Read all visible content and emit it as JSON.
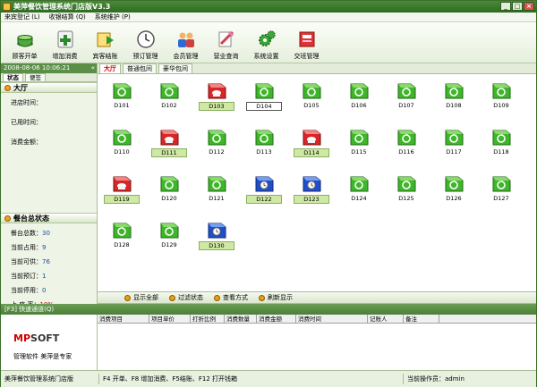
{
  "window": {
    "title": "美萍餐饮管理系统门店版V3.3",
    "min": "_",
    "max": "□",
    "close": "×"
  },
  "menu": [
    "来宾登记 (L)",
    "收银结算 (Q)",
    "系统维护 (P)"
  ],
  "toolbar": [
    {
      "label": "顾客开单",
      "icon": "teacup-icon"
    },
    {
      "label": "增加消费",
      "icon": "add-consume-icon"
    },
    {
      "label": "宾客结账",
      "icon": "checkout-icon"
    },
    {
      "label": "预订管理",
      "icon": "clock-icon"
    },
    {
      "label": "会员管理",
      "icon": "members-icon"
    },
    {
      "label": "营业查询",
      "icon": "search-icon"
    },
    {
      "label": "系统设置",
      "icon": "gear-icon"
    },
    {
      "label": "交班管理",
      "icon": "shift-icon"
    }
  ],
  "left": {
    "datetime": "2008-08-06 10:06:21",
    "collapse": "«",
    "tabs": [
      "状态",
      "便签"
    ],
    "hall_title": "大厅",
    "fields": [
      "进店时间：",
      "已用时间：",
      "消费金额："
    ],
    "stats_title": "餐台总状态",
    "stats": [
      {
        "label": "餐台总数：",
        "value": "30"
      },
      {
        "label": "当前占用：",
        "value": "9"
      },
      {
        "label": "当前可供：",
        "value": "76"
      },
      {
        "label": "当前预订：",
        "value": "1"
      },
      {
        "label": "当前停用：",
        "value": "0"
      },
      {
        "label": "上 座 率：",
        "value": "10%"
      }
    ]
  },
  "main": {
    "tabs": [
      "大厅",
      "普通包间",
      "豪华包间"
    ],
    "tables": [
      {
        "id": "D101",
        "state": "free"
      },
      {
        "id": "D102",
        "state": "free"
      },
      {
        "id": "D103",
        "state": "busy",
        "mark": "sel"
      },
      {
        "id": "D104",
        "state": "free",
        "mark": "box"
      },
      {
        "id": "D105",
        "state": "free"
      },
      {
        "id": "D106",
        "state": "free"
      },
      {
        "id": "D107",
        "state": "free"
      },
      {
        "id": "D108",
        "state": "free"
      },
      {
        "id": "D109",
        "state": "free"
      },
      {
        "id": "D110",
        "state": "free"
      },
      {
        "id": "D111",
        "state": "busy",
        "mark": "sel"
      },
      {
        "id": "D112",
        "state": "free"
      },
      {
        "id": "D113",
        "state": "free"
      },
      {
        "id": "D114",
        "state": "busy",
        "mark": "sel"
      },
      {
        "id": "D115",
        "state": "free"
      },
      {
        "id": "D116",
        "state": "free"
      },
      {
        "id": "D117",
        "state": "free"
      },
      {
        "id": "D118",
        "state": "free"
      },
      {
        "id": "D119",
        "state": "busy",
        "mark": "sel"
      },
      {
        "id": "D120",
        "state": "free"
      },
      {
        "id": "D121",
        "state": "free"
      },
      {
        "id": "D122",
        "state": "reserved",
        "mark": "sel"
      },
      {
        "id": "D123",
        "state": "reserved",
        "mark": "sel"
      },
      {
        "id": "D124",
        "state": "free"
      },
      {
        "id": "D125",
        "state": "free"
      },
      {
        "id": "D126",
        "state": "free"
      },
      {
        "id": "D127",
        "state": "free"
      },
      {
        "id": "D128",
        "state": "free"
      },
      {
        "id": "D129",
        "state": "free"
      },
      {
        "id": "D130",
        "state": "reserved",
        "mark": "sel"
      }
    ]
  },
  "actions": [
    "显示全部",
    "过滤状态",
    "查看方式",
    "刷新显示"
  ],
  "quick": {
    "label": "[F3] 快速通道(Q)"
  },
  "logo": {
    "brand_mp": "MP",
    "brand_soft": "SOFT",
    "caption": "管理软件 美萍是专家"
  },
  "bottom_columns": [
    "消费项目",
    "项目单价",
    "打折比例",
    "消费数量",
    "消费金额",
    "消费时间",
    "记账人",
    "备注"
  ],
  "status": {
    "app": "美萍餐饮管理系统门店版",
    "shortcuts": "F4 开单、F8 增加消费、F5结账、F12 打开钱箱",
    "operator": "当前操作员：admin"
  },
  "colors": {
    "free": "#3fb52a",
    "busy": "#d62828",
    "reserved": "#1f4fc8"
  }
}
